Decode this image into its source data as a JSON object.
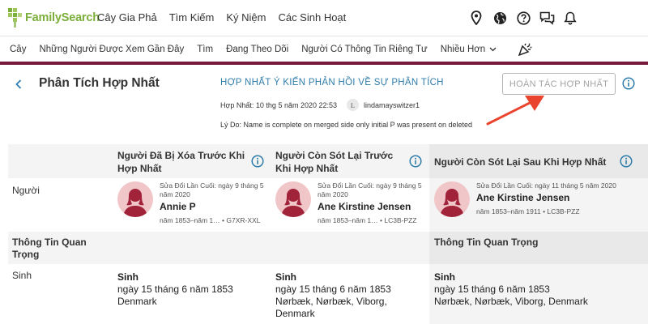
{
  "brand": {
    "name": "FamilySearch",
    "accent": "#7bae3a",
    "maroon": "#76193a",
    "link": "#2f7daa"
  },
  "topnav": [
    "Cây Gia Phả",
    "Tìm Kiếm",
    "Ký Niệm",
    "Các Sinh Hoạt"
  ],
  "topicons": [
    "location-pin-icon",
    "globe-icon",
    "help-icon",
    "messages-icon",
    "bell-icon"
  ],
  "subnav": {
    "items": [
      "Cây",
      "Những Người Được Xem Gần Đây",
      "Tìm",
      "Đang Theo Dõi",
      "Người Có Thông Tin Riêng Tư"
    ],
    "more": "Nhiều Hơn"
  },
  "header": {
    "title": "Phân Tích Hợp Nhất",
    "feedback_link": "HỢP NHẤT Ý KIẾN PHẢN HỒI VỀ SỰ PHÂN TÍCH",
    "merged_on": "Hợp Nhất: 10 thg 5 năm 2020 22:53",
    "user_initial": "L",
    "user": "lindamayswitzer1",
    "reason": "Lý Do: Name is complete on merged side only initial P was present on deleted",
    "undo_button": "HOÀN TÁC HỢP NHẤT"
  },
  "columns": {
    "deleted": "Người Đã Bị Xóa Trước Khi Hợp Nhất",
    "surviving_before": "Người Còn Sót Lại Trước Khi Hợp Nhất",
    "surviving_after": "Người Còn Sót Lại Sau Khi Hợp Nhất"
  },
  "rows": {
    "person": "Người",
    "vital_info": "Thông Tin Quan Trọng",
    "birth": "Sinh"
  },
  "persons": [
    {
      "last_modified": "Sửa Đổi Lần Cuối: ngày 9 tháng 5 năm 2020",
      "name": "Annie P",
      "meta": "năm 1853–năm 1…  •  G7XR-XXL"
    },
    {
      "last_modified": "Sửa Đổi Lần Cuối: ngày 9 tháng 5 năm 2020",
      "name": "Ane Kirstine Jensen",
      "meta": "năm 1853–năm 1…  •  LC3B-PZZ"
    },
    {
      "last_modified": "Sửa Đổi Lần Cuối: ngày 11 tháng 5 năm 2020",
      "name": "Ane Kirstine Jensen",
      "meta": "năm 1853–năm 1911  •  LC3B-PZZ"
    }
  ],
  "vital_after_label": "Thông Tin Quan Trọng",
  "births": [
    {
      "title": "Sinh",
      "date": "ngày 15 tháng 6 năm 1853",
      "place": "Denmark"
    },
    {
      "title": "Sinh",
      "date": "ngày 15 tháng 6 năm 1853",
      "place": "Nørbæk, Nørbæk, Viborg, Denmark"
    },
    {
      "title": "Sinh",
      "date": "ngày 15 tháng 6 năm 1853",
      "place": "Nørbæk, Nørbæk, Viborg, Denmark"
    }
  ]
}
